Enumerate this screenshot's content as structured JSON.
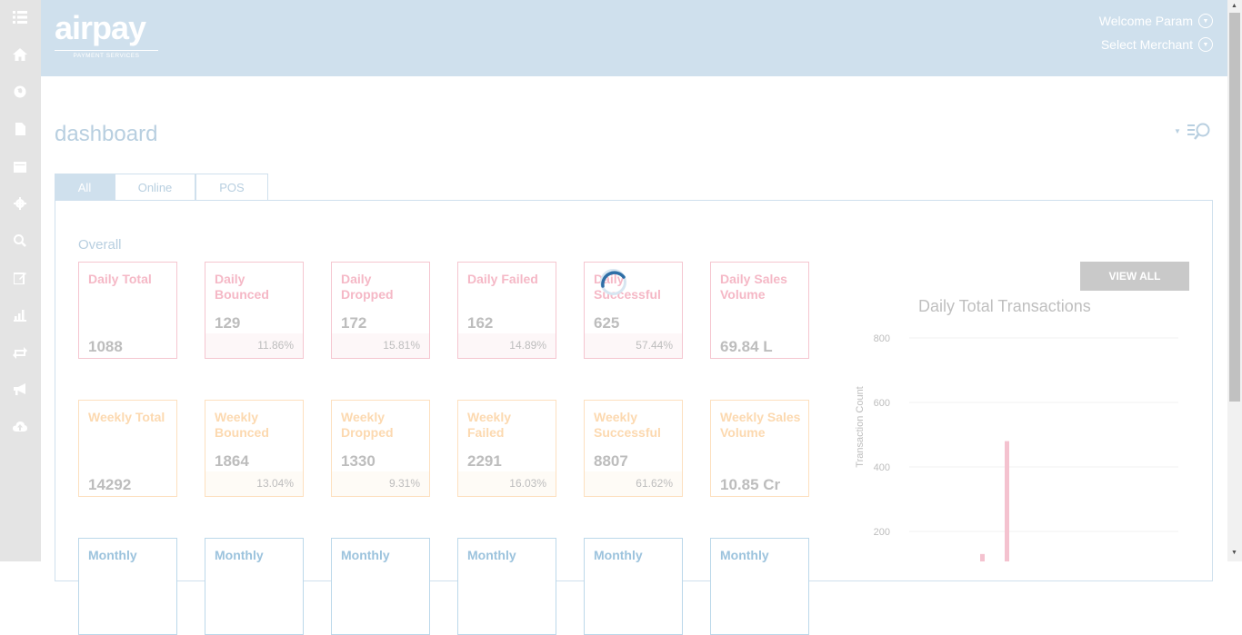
{
  "sidebar": {
    "icons": [
      "menu-icon",
      "home-icon",
      "globe-icon",
      "document-icon",
      "calendar-icon",
      "gear-icon",
      "search-icon",
      "edit-icon",
      "bar-chart-icon",
      "refresh-icon",
      "megaphone-icon",
      "upload-icon"
    ]
  },
  "header": {
    "logo_text": "airpay",
    "logo_sub": "PAYMENT SERVICES",
    "welcome": "Welcome Param",
    "merchant": "Select Merchant"
  },
  "page": {
    "title": "dashboard"
  },
  "tabs": [
    "All",
    "Online",
    "POS"
  ],
  "overall_label": "Overall",
  "daily_cards": [
    {
      "label": "Daily Total",
      "value": "1088",
      "pct": ""
    },
    {
      "label": "Daily Bounced",
      "value": "129",
      "pct": "11.86%"
    },
    {
      "label": "Daily Dropped",
      "value": "172",
      "pct": "15.81%"
    },
    {
      "label": "Daily Failed",
      "value": "162",
      "pct": "14.89%"
    },
    {
      "label": "Daily Successful",
      "value": "625",
      "pct": "57.44%"
    },
    {
      "label": "Daily Sales Volume",
      "value": "69.84 L",
      "pct": ""
    }
  ],
  "weekly_cards": [
    {
      "label": "Weekly Total",
      "value": "14292",
      "pct": ""
    },
    {
      "label": "Weekly Bounced",
      "value": "1864",
      "pct": "13.04%"
    },
    {
      "label": "Weekly Dropped",
      "value": "1330",
      "pct": "9.31%"
    },
    {
      "label": "Weekly Failed",
      "value": "2291",
      "pct": "16.03%"
    },
    {
      "label": "Weekly Successful",
      "value": "8807",
      "pct": "61.62%"
    },
    {
      "label": "Weekly Sales Volume",
      "value": "10.85 Cr",
      "pct": ""
    }
  ],
  "monthly_cards": [
    {
      "label": "Monthly"
    },
    {
      "label": "Monthly"
    },
    {
      "label": "Monthly"
    },
    {
      "label": "Monthly"
    },
    {
      "label": "Monthly"
    },
    {
      "label": "Monthly"
    }
  ],
  "view_all_label": "VIEW ALL",
  "chart_data": {
    "type": "bar",
    "title": "Daily Total Transactions",
    "xlabel": "",
    "ylabel": "Transaction Count",
    "ylim": [
      100,
      800
    ],
    "yticks": [
      "800",
      "600",
      "400",
      "200"
    ],
    "values": [
      105,
      130,
      480
    ],
    "color": "#f4c2cf"
  },
  "colors": {
    "header_bg": "#cfe0ed",
    "sidebar_bg": "#e4e4e4",
    "daily_border": "#f5c6d0",
    "weekly_border": "#fde0bf",
    "monthly_border": "#bcd8ea"
  }
}
